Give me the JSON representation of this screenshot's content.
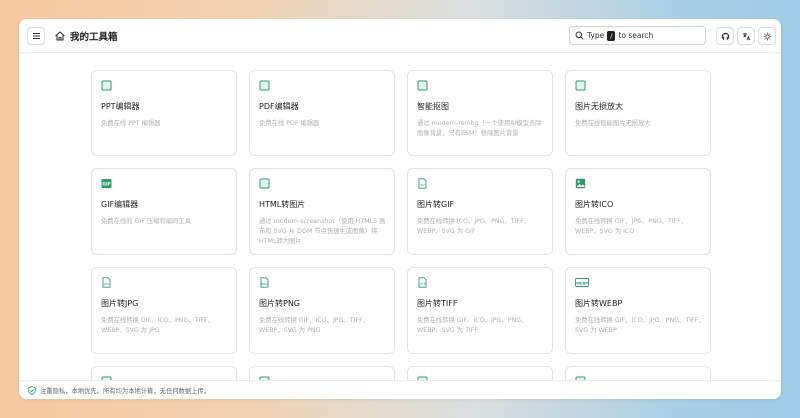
{
  "header": {
    "title": "我的工具箱",
    "search": {
      "prefix": "Type",
      "key": "/",
      "suffix": "to search"
    }
  },
  "tools": [
    {
      "icon": "square-icon",
      "title": "PPT编辑器",
      "desc": "免费在线 PPT 编辑器"
    },
    {
      "icon": "square-icon",
      "title": "PDF编辑器",
      "desc": "免费在线 PDF 编辑器"
    },
    {
      "icon": "square-icon",
      "title": "智能抠图",
      "desc": "通过 modern-rembg（一个使用AI模型去除图像背景，只有ESM）移除图片背景"
    },
    {
      "icon": "square-icon",
      "title": "图片无损放大",
      "desc": "免费在线智能图片无损放大"
    },
    {
      "icon": "gif-icon",
      "title": "GIF编辑器",
      "desc": "免费在线的 GIF 压缩和编码工具"
    },
    {
      "icon": "square-icon",
      "title": "HTML转图片",
      "desc": "通过 modern-screenshot（使用 HTML5 画布和 SVG 从 DOM 节点快速生成图像）将HTML转为图片"
    },
    {
      "icon": "file-gif-icon",
      "title": "图片转GIF",
      "desc": "免费在线转换 ICO、JPG、PNG、TIFF、WEBP、SVG 为 GIF"
    },
    {
      "icon": "image-icon",
      "title": "图片转ICO",
      "desc": "免费在线转换 GIF、JPG、PNG、TIFF、WEBP、SVG 为 ICO"
    },
    {
      "icon": "file-jpg-icon",
      "title": "图片转JPG",
      "desc": "免费在线转换 GIF、ICO、PNG、TIFF、WEBP、SVG 为 JPG"
    },
    {
      "icon": "file-png-icon",
      "title": "图片转PNG",
      "desc": "免费在线转换 GIF、ICO、JPG、TIFF、WEBP、SVG 为 PNG"
    },
    {
      "icon": "file-tiff-icon",
      "title": "图片转TIFF",
      "desc": "免费在线转换 GIF、ICO、JPG、PNG、WEBP、SVG 为 TIFF"
    },
    {
      "icon": "webp-icon",
      "title": "图片转WEBP",
      "desc": "免费在线转换 GIF、ICO、JPG、PNG、TIFF、SVG 为 WEBP"
    }
  ],
  "footer": {
    "text": "注重隐私，本地优先。所有均为本地计算，无任何数据上传。"
  },
  "colors": {
    "accent": "#2a9d6a",
    "border": "#e3e3e3",
    "muted": "#b0b0b0"
  }
}
